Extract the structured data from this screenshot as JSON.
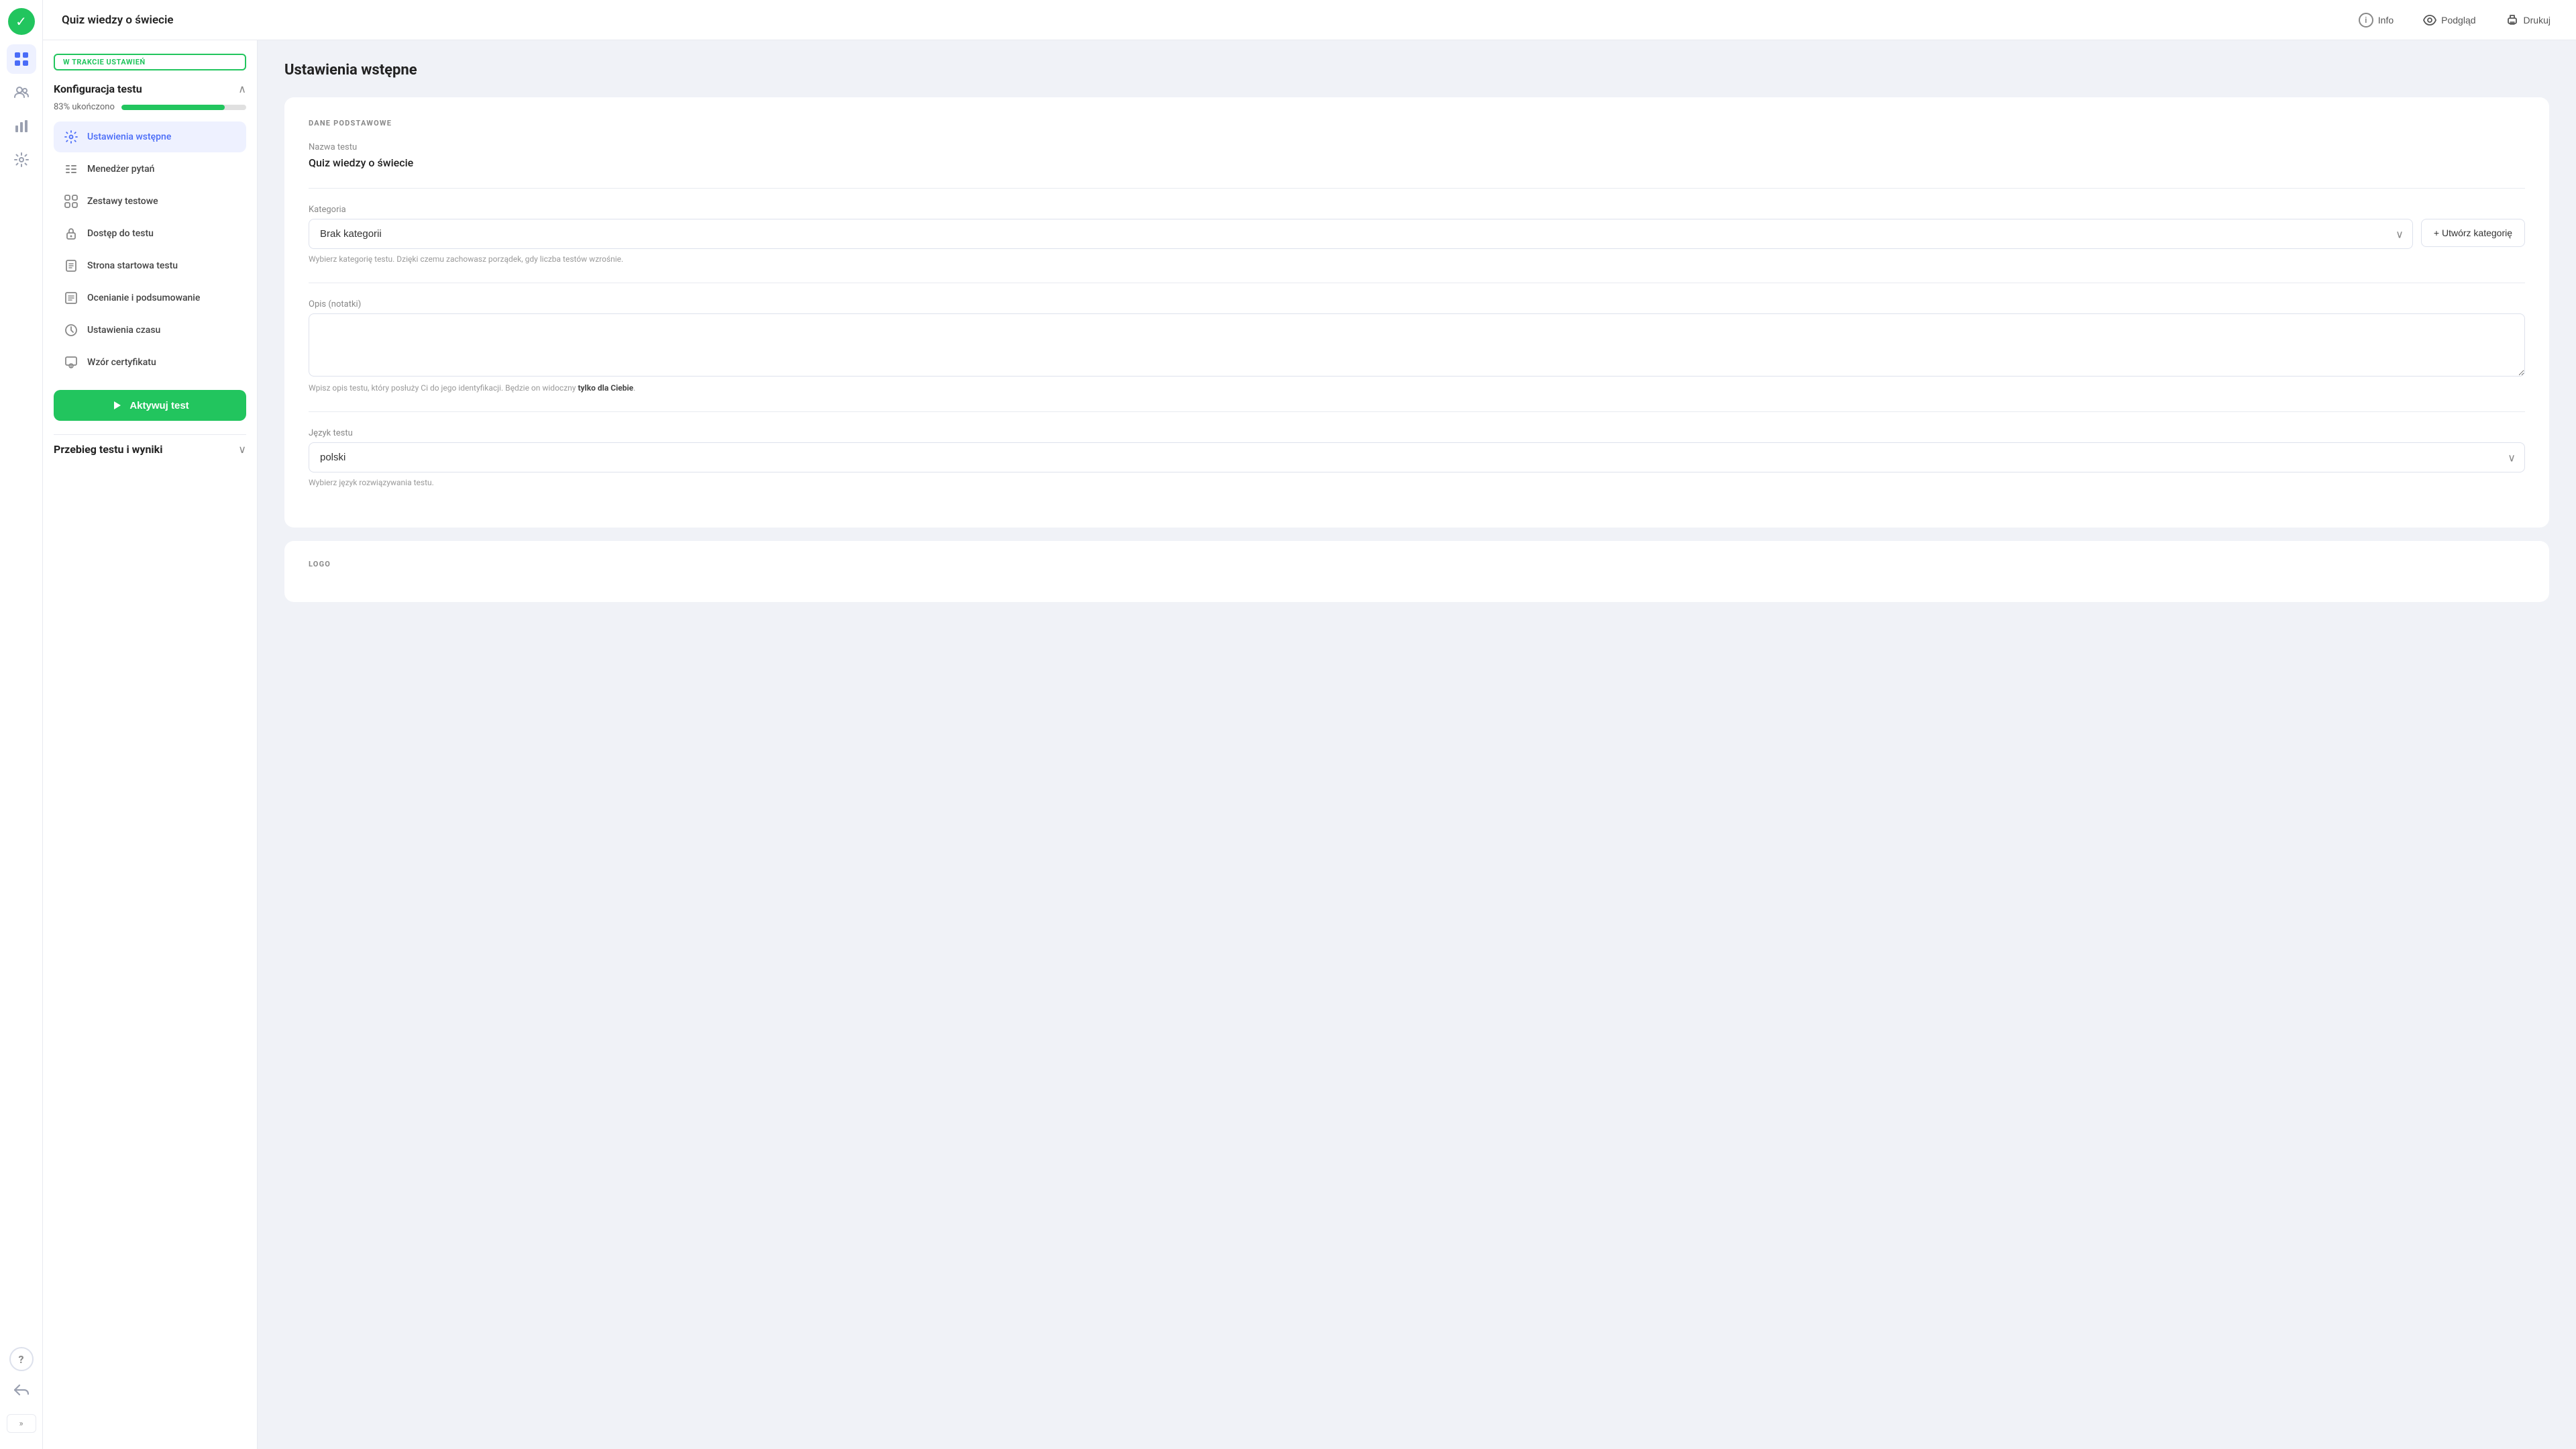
{
  "app": {
    "brand_icon": "✓",
    "title": "Quiz wiedzy o świecie"
  },
  "header": {
    "title": "Quiz wiedzy o świecie",
    "actions": {
      "info_label": "Info",
      "preview_label": "Podgląd",
      "print_label": "Drukuj"
    }
  },
  "sidebar": {
    "status_badge": "W TRAKCIE USTAWIEŃ",
    "konfiguracja_section": "Konfiguracja testu",
    "progress_label": "83% ukończono",
    "progress_value": 83,
    "nav_items": [
      {
        "id": "ustawienia-wstepne",
        "label": "Ustawienia wstępne",
        "icon": "⚙",
        "active": true
      },
      {
        "id": "menedzer-pytan",
        "label": "Menedżer pytań",
        "icon": "≡",
        "active": false
      },
      {
        "id": "zestawy-testowe",
        "label": "Zestawy testowe",
        "icon": "⊞",
        "active": false
      },
      {
        "id": "dostep-do-testu",
        "label": "Dostęp do testu",
        "icon": "🔒",
        "active": false
      },
      {
        "id": "strona-startowa",
        "label": "Strona startowa testu",
        "icon": "📄",
        "active": false
      },
      {
        "id": "ocenianie",
        "label": "Ocenianie i podsumowanie",
        "icon": "📋",
        "active": false
      },
      {
        "id": "ustawienia-czasu",
        "label": "Ustawienia czasu",
        "icon": "🕐",
        "active": false
      },
      {
        "id": "wzor-certyfikatu",
        "label": "Wzór certyfikatu",
        "icon": "📜",
        "active": false
      }
    ],
    "activate_btn": "Aktywuj test",
    "przebieg_section": "Przebieg testu i wyniki"
  },
  "main": {
    "section_title": "Ustawienia wstępne",
    "subsection_label": "DANE PODSTAWOWE",
    "field_nazwa_label": "Nazwa testu",
    "field_nazwa_value": "Quiz wiedzy o świecie",
    "field_kategoria_label": "Kategoria",
    "field_kategoria_value": "Brak kategorii",
    "field_kategoria_helper": "Wybierz kategorię testu. Dzięki czemu zachowasz porządek, gdy liczba testów wzrośnie.",
    "create_category_label": "+ Utwórz kategorię",
    "field_opis_label": "Opis (notatki)",
    "field_opis_helper_pre": "Wpisz opis testu, który posłuży Ci do jego identyfikacji. Będzie on widoczny ",
    "field_opis_helper_bold": "tylko dla Ciebie",
    "field_opis_helper_post": ".",
    "field_jezyk_label": "Język testu",
    "field_jezyk_value": "polski",
    "field_jezyk_helper": "Wybierz język rozwiązywania testu.",
    "section2_label": "LOGO"
  },
  "rail_icons": [
    {
      "id": "grid-icon",
      "symbol": "⊞",
      "active": true
    },
    {
      "id": "users-icon",
      "symbol": "👥",
      "active": false
    },
    {
      "id": "analytics-icon",
      "symbol": "📊",
      "active": false
    },
    {
      "id": "settings-icon",
      "symbol": "⚙",
      "active": false
    }
  ],
  "rail_bottom_icons": [
    {
      "id": "help-icon",
      "symbol": "?"
    },
    {
      "id": "back-icon",
      "symbol": "↩"
    }
  ],
  "expand_label": "»"
}
